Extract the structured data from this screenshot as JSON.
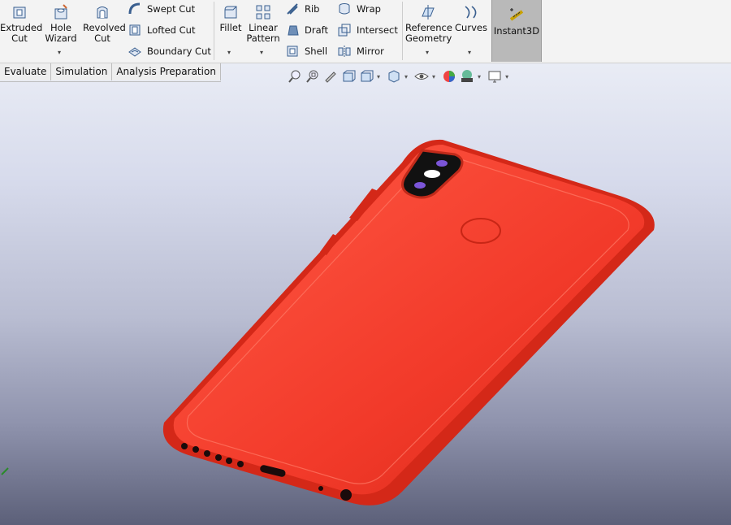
{
  "ribbon": {
    "extruded_cut": "Extruded\nCut",
    "extruded_cut_l1": "Extruded",
    "extruded_cut_l2": "Cut",
    "hole_wizard_l1": "Hole",
    "hole_wizard_l2": "Wizard",
    "revolved_cut_l1": "Revolved",
    "revolved_cut_l2": "Cut",
    "swept_cut": "Swept Cut",
    "lofted_cut": "Lofted Cut",
    "boundary_cut": "Boundary Cut",
    "fillet": "Fillet",
    "linear_pattern_l1": "Linear",
    "linear_pattern_l2": "Pattern",
    "rib": "Rib",
    "draft": "Draft",
    "shell": "Shell",
    "wrap": "Wrap",
    "intersect": "Intersect",
    "mirror": "Mirror",
    "reference_geometry_l1": "Reference",
    "reference_geometry_l2": "Geometry",
    "curves": "Curves",
    "instant3d": "Instant3D"
  },
  "tabs": [
    "Evaluate",
    "Simulation",
    "Analysis Preparation"
  ],
  "view_icons": [
    "zoom-to-fit-icon",
    "zoom-area-icon",
    "previous-view-icon",
    "section-view-icon",
    "view-orientation-icon",
    "display-style-icon",
    "hide-show-icon",
    "edit-appearance-icon",
    "apply-scene-icon",
    "view-settings-icon"
  ],
  "colors": {
    "accent": "#b9b9b9",
    "phone_body": "#f23a2a",
    "ribbon_bg": "#f3f3f3"
  }
}
